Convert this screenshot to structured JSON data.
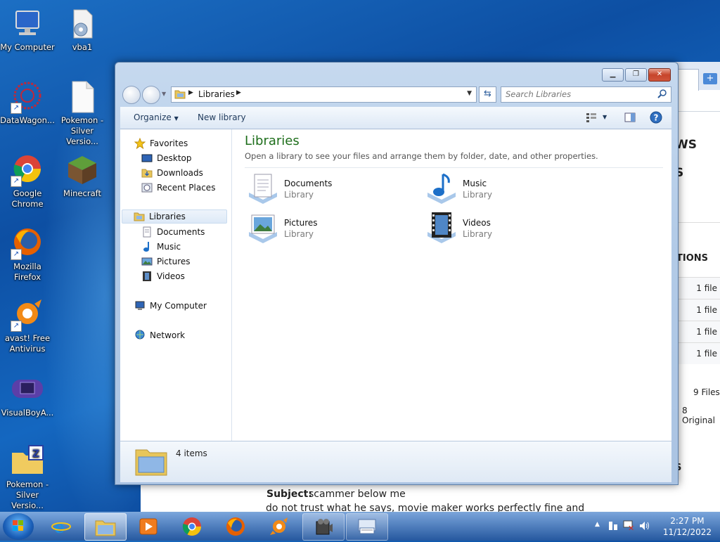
{
  "desktop": {
    "icons": [
      {
        "label": "My Computer"
      },
      {
        "label": "vba1"
      },
      {
        "label": "DataWagon..."
      },
      {
        "label": "Pokemon - Silver Versio..."
      },
      {
        "label": "Google Chrome"
      },
      {
        "label": "Minecraft"
      },
      {
        "label": "Mozilla Firefox"
      },
      {
        "label": "avast! Free Antivirus"
      },
      {
        "label": "VisualBoyA..."
      },
      {
        "label": "Pokemon - Silver Versio..."
      }
    ]
  },
  "browser_bg": {
    "heading_1": "WS",
    "heading_2": "S",
    "section": "TIONS",
    "rows": [
      "1 file",
      "1 file",
      "1 file",
      "1 file"
    ],
    "files_total": "9 Files",
    "originals": "8 Original",
    "bottom_heading": "S",
    "post_subject_label": "Subject:",
    "post_subject": "scammer below me",
    "post_body": "do not trust what he says, movie maker works perfectly fine and"
  },
  "explorer": {
    "address": {
      "location": "Libraries"
    },
    "search": {
      "placeholder": "Search Libraries"
    },
    "toolbar": {
      "organize": "Organize",
      "new_library": "New library"
    },
    "nav": {
      "favorites": "Favorites",
      "desktop": "Desktop",
      "downloads": "Downloads",
      "recent": "Recent Places",
      "libraries": "Libraries",
      "documents": "Documents",
      "music": "Music",
      "pictures": "Pictures",
      "videos": "Videos",
      "computer": "My Computer",
      "network": "Network"
    },
    "main": {
      "title": "Libraries",
      "subtitle": "Open a library to see your files and arrange them by folder, date, and other properties.",
      "libraries": [
        {
          "name": "Documents",
          "kind": "Library"
        },
        {
          "name": "Music",
          "kind": "Library"
        },
        {
          "name": "Pictures",
          "kind": "Library"
        },
        {
          "name": "Videos",
          "kind": "Library"
        }
      ]
    },
    "details": {
      "count": "4 items"
    }
  },
  "taskbar": {
    "clock_time": "2:27 PM",
    "clock_date": "11/12/2022"
  }
}
